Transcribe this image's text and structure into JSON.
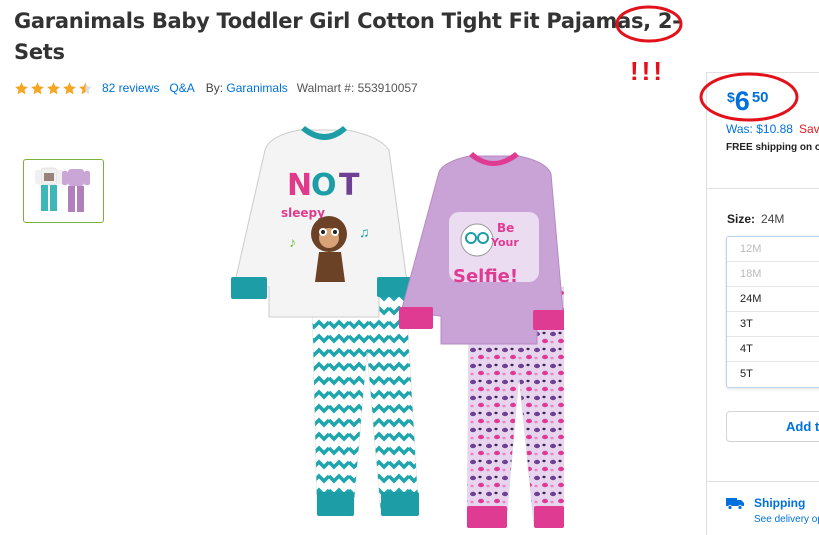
{
  "product": {
    "title_line1": "Garanimals Baby Toddler Girl Cotton Tight Fit Pajamas, 2-",
    "title_line2": "Sets",
    "rating": 4.5,
    "rating_max": 5,
    "reviews_label": "82 reviews",
    "qa_label": "Q&A",
    "by_label": "By:",
    "brand": "Garanimals",
    "walmart_label": "Walmart #: 553910057"
  },
  "annotation": {
    "exclaim": "!!!",
    "circle_color": "#e3111a"
  },
  "price": {
    "currency": "$",
    "dollars": "6",
    "cents": "50",
    "was_label": "Was: $10.88",
    "save_label": "Sav",
    "free_shipping": "FREE shipping on or"
  },
  "size": {
    "label": "Size:",
    "selected": "24M",
    "options": [
      {
        "label": "12M",
        "available": false
      },
      {
        "label": "18M",
        "available": false
      },
      {
        "label": "24M",
        "available": true
      },
      {
        "label": "3T",
        "available": true
      },
      {
        "label": "4T",
        "available": true
      },
      {
        "label": "5T",
        "available": true
      }
    ]
  },
  "actions": {
    "add_label": "Add to"
  },
  "shipping": {
    "label": "Shipping",
    "sub": "See delivery op"
  },
  "colors": {
    "accent": "#0071dc",
    "star": "#f5a623",
    "annotation": "#e3111a"
  }
}
